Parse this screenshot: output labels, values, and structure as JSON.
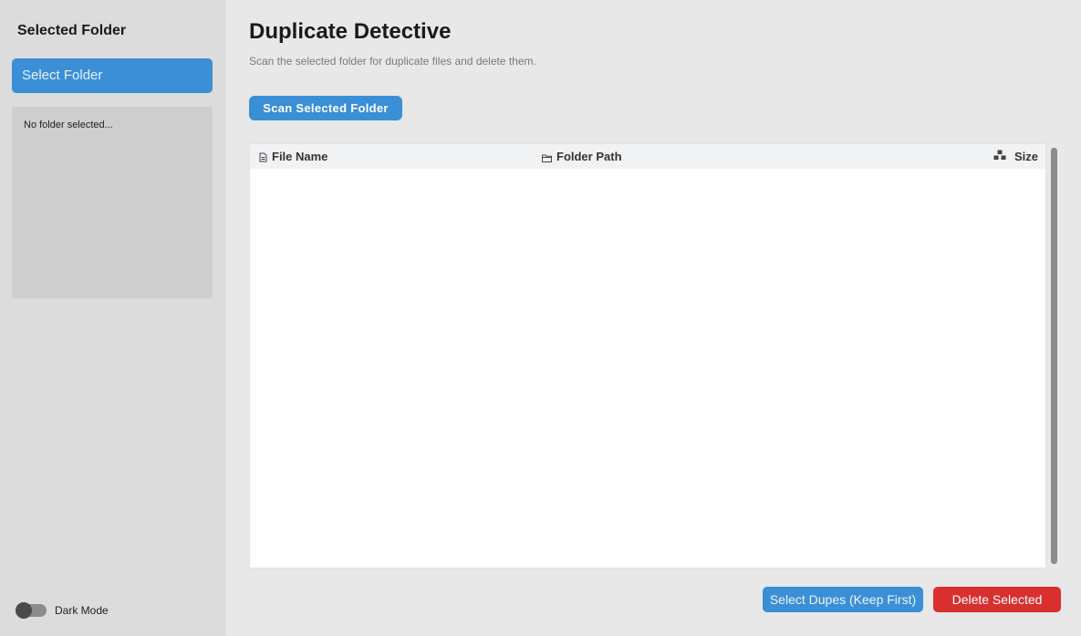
{
  "sidebar": {
    "title": "Selected Folder",
    "select_folder_label": "Select Folder",
    "folder_status": "No folder selected...",
    "dark_mode_label": "Dark Mode",
    "dark_mode_enabled": false
  },
  "main": {
    "title": "Duplicate Detective",
    "subtitle": "Scan the selected folder for duplicate files and delete them.",
    "scan_button_label": "Scan Selected Folder"
  },
  "table": {
    "columns": [
      {
        "label": "File Name",
        "icon": "file-icon"
      },
      {
        "label": "Folder Path",
        "icon": "folder-icon"
      },
      {
        "label": "Size",
        "icon": "size-icon"
      }
    ],
    "rows": []
  },
  "actions": {
    "select_dupes_label": "Select Dupes (Keep First)",
    "delete_selected_label": "Delete Selected"
  },
  "colors": {
    "accent": "#3a8fd6",
    "danger": "#d92f2f",
    "sidebar_bg": "#dcdcdc",
    "main_bg": "#e8e8e8"
  }
}
